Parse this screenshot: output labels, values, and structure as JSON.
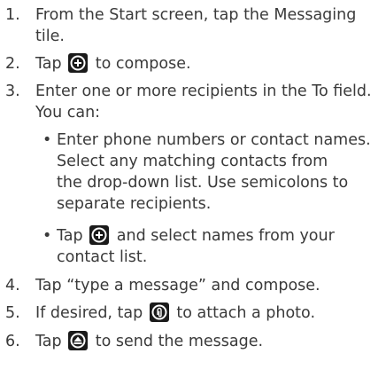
{
  "steps": [
    {
      "num": "1.",
      "line1": "From the Start screen, tap the Messaging",
      "line2": "tile."
    },
    {
      "num": "2.",
      "pre": "Tap",
      "post": "to compose.",
      "icon": "compose-icon"
    },
    {
      "num": "3.",
      "line1": "Enter one or more recipients in the To field.",
      "line2": "You can:"
    },
    {
      "num": "4.",
      "text": "Tap “type a message” and compose."
    },
    {
      "num": "5.",
      "pre": "If desired, tap",
      "post": "to attach a photo.",
      "icon": "attach-icon"
    },
    {
      "num": "6.",
      "pre": "Tap",
      "post": "to send the message.",
      "icon": "send-icon"
    }
  ],
  "bullets": [
    {
      "dot": "•",
      "lines": [
        "Enter phone numbers or contact names.",
        "Select any matching contacts from",
        "the drop-down list. Use semicolons to",
        "separate recipients."
      ]
    },
    {
      "dot": "•",
      "pre": "Tap",
      "post": "and select names from your",
      "line2": "contact list.",
      "icon": "add-contact-icon"
    }
  ]
}
